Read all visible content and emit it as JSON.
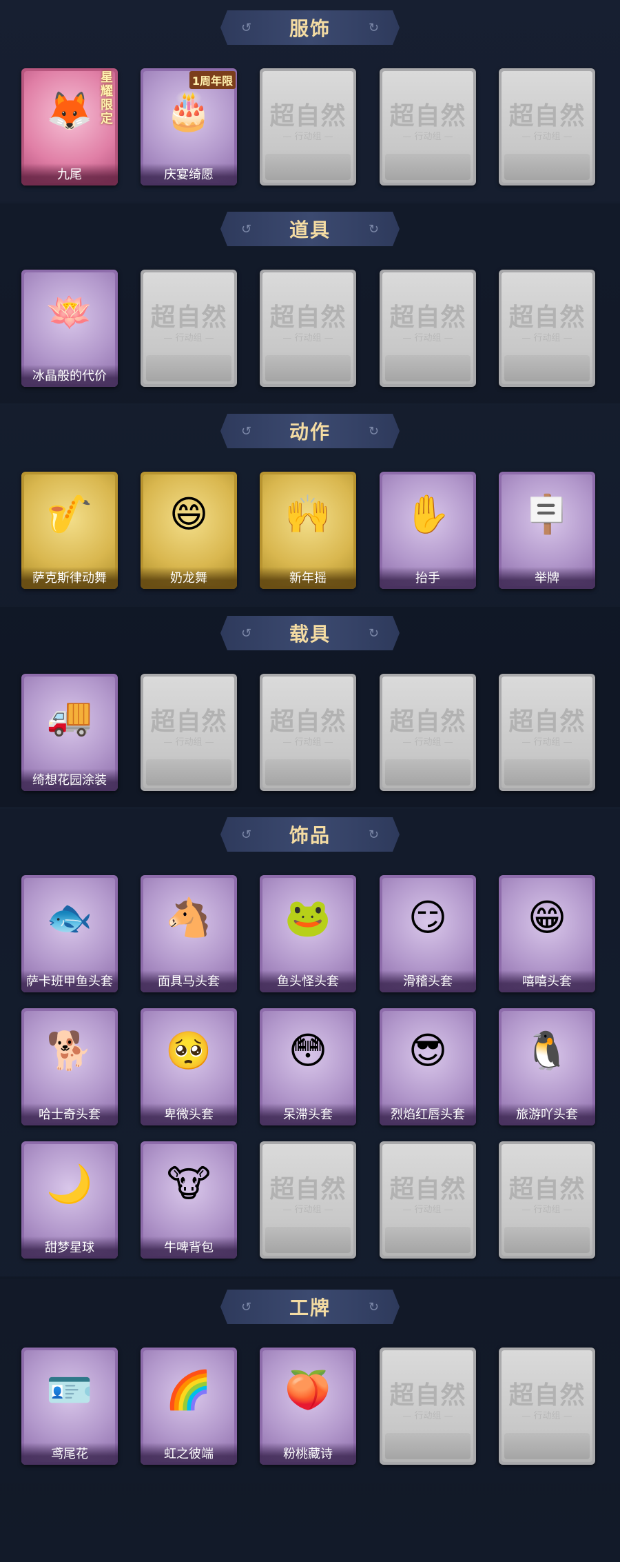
{
  "sections": [
    {
      "title": "服饰",
      "items": [
        {
          "label": "九尾",
          "style": "pink",
          "icon": "fox-costume-icon",
          "glyph": "🦊",
          "badge": "星耀限定"
        },
        {
          "label": "庆宴绮愿",
          "style": "purple",
          "icon": "anniversary-costume-icon",
          "glyph": "🎂",
          "badge": "1周年限"
        },
        {
          "label": "",
          "style": "grey"
        },
        {
          "label": "",
          "style": "grey"
        },
        {
          "label": "",
          "style": "grey"
        }
      ]
    },
    {
      "title": "道具",
      "items": [
        {
          "label": "冰晶般的代价",
          "style": "purple",
          "icon": "crystal-lotus-icon",
          "glyph": "🪷"
        },
        {
          "label": "",
          "style": "grey"
        },
        {
          "label": "",
          "style": "grey"
        },
        {
          "label": "",
          "style": "grey"
        },
        {
          "label": "",
          "style": "grey"
        }
      ]
    },
    {
      "title": "动作",
      "items": [
        {
          "label": "萨克斯律动舞",
          "style": "gold",
          "icon": "saxophone-dance-icon",
          "glyph": "🎷"
        },
        {
          "label": "奶龙舞",
          "style": "gold",
          "icon": "dance-emote-icon",
          "glyph": "😄"
        },
        {
          "label": "新年摇",
          "style": "gold",
          "icon": "newyear-shake-icon",
          "glyph": "🙌"
        },
        {
          "label": "抬手",
          "style": "purple",
          "icon": "raise-hand-icon",
          "glyph": "✋"
        },
        {
          "label": "举牌",
          "style": "purple",
          "icon": "hold-sign-icon",
          "glyph": "🪧"
        }
      ]
    },
    {
      "title": "载具",
      "items": [
        {
          "label": "绮想花园涂装",
          "style": "purple",
          "icon": "garden-vehicle-icon",
          "glyph": "🚚"
        },
        {
          "label": "",
          "style": "grey"
        },
        {
          "label": "",
          "style": "grey"
        },
        {
          "label": "",
          "style": "grey"
        },
        {
          "label": "",
          "style": "grey"
        }
      ]
    },
    {
      "title": "饰品",
      "items": [
        {
          "label": "萨卡班甲鱼头套",
          "style": "purple",
          "icon": "fish-mask-icon",
          "glyph": "🐟"
        },
        {
          "label": "面具马头套",
          "style": "purple",
          "icon": "horse-mask-icon",
          "glyph": "🐴"
        },
        {
          "label": "鱼头怪头套",
          "style": "purple",
          "icon": "fishhead-mask-icon",
          "glyph": "🐸"
        },
        {
          "label": "滑稽头套",
          "style": "purple",
          "icon": "funny-face-mask-icon",
          "glyph": "😏"
        },
        {
          "label": "嘻嘻头套",
          "style": "purple",
          "icon": "grin-mask-icon",
          "glyph": "😁"
        },
        {
          "label": "哈士奇头套",
          "style": "purple",
          "icon": "husky-mask-icon",
          "glyph": "🐕"
        },
        {
          "label": "卑微头套",
          "style": "purple",
          "icon": "humble-mask-icon",
          "glyph": "🥺"
        },
        {
          "label": "呆滞头套",
          "style": "purple",
          "icon": "dazed-mask-icon",
          "glyph": "😳"
        },
        {
          "label": "烈焰红唇头套",
          "style": "purple",
          "icon": "red-lips-mask-icon",
          "glyph": "😎"
        },
        {
          "label": "旅游吖头套",
          "style": "purple",
          "icon": "tourist-mask-icon",
          "glyph": "🐧"
        },
        {
          "label": "甜梦星球",
          "style": "purple",
          "icon": "dream-planet-icon",
          "glyph": "🌙"
        },
        {
          "label": "牛啤背包",
          "style": "purple",
          "icon": "cow-backpack-icon",
          "glyph": "🐮"
        },
        {
          "label": "",
          "style": "grey"
        },
        {
          "label": "",
          "style": "grey"
        },
        {
          "label": "",
          "style": "grey"
        }
      ]
    },
    {
      "title": "工牌",
      "items": [
        {
          "label": "鸢尾花",
          "style": "purple",
          "icon": "iris-badge-icon",
          "glyph": "🪪"
        },
        {
          "label": "虹之彼端",
          "style": "purple",
          "icon": "rainbow-badge-icon",
          "glyph": "🌈"
        },
        {
          "label": "粉桃藏诗",
          "style": "purple",
          "icon": "peach-badge-icon",
          "glyph": "🍑"
        },
        {
          "label": "",
          "style": "grey"
        },
        {
          "label": "",
          "style": "grey"
        }
      ]
    }
  ],
  "placeholder": {
    "text": "超自然",
    "sub": "— 行动组 —"
  },
  "header_ornaments": {
    "left": "↺",
    "right": "↻"
  },
  "colors": {
    "header_text": "#f4dca3",
    "background": "#111828"
  }
}
